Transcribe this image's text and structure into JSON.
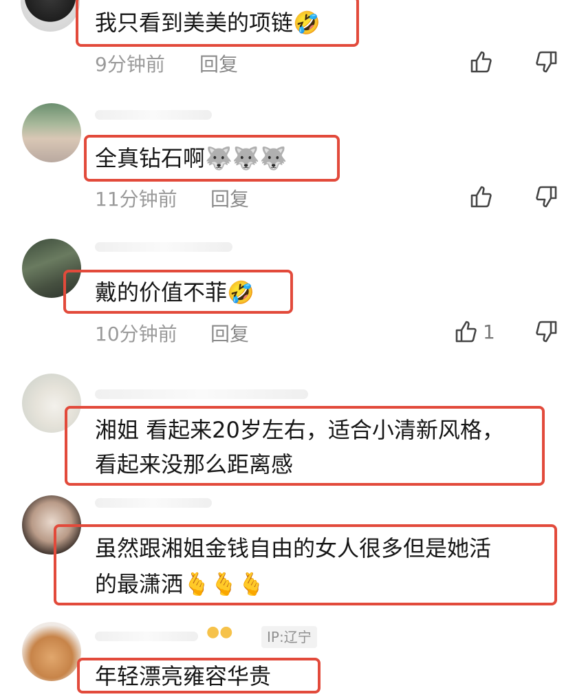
{
  "comments": [
    {
      "text": "我只看到美美的项链🤣",
      "time": "9分钟前",
      "reply": "回复",
      "likes": ""
    },
    {
      "text": "全真钻石啊🐺🐺🐺",
      "time": "11分钟前",
      "reply": "回复",
      "likes": ""
    },
    {
      "text": "戴的价值不菲🤣",
      "time": "10分钟前",
      "reply": "回复",
      "likes": "1"
    },
    {
      "line1": "湘姐 看起来20岁左右，适合小清新风格，",
      "line2": "看起来没那么距离感"
    },
    {
      "line1": "虽然跟湘姐金钱自由的女人很多但是她活",
      "line2": "的最潇洒🫰🫰🫰"
    },
    {
      "text": "年轻漂亮雍容华贵",
      "ip": "IP:辽宁"
    }
  ],
  "colors": {
    "highlight_border": "#e24a3b",
    "meta_text": "#9a9a9a"
  },
  "icons": [
    "thumb-up-icon",
    "thumb-down-icon"
  ]
}
